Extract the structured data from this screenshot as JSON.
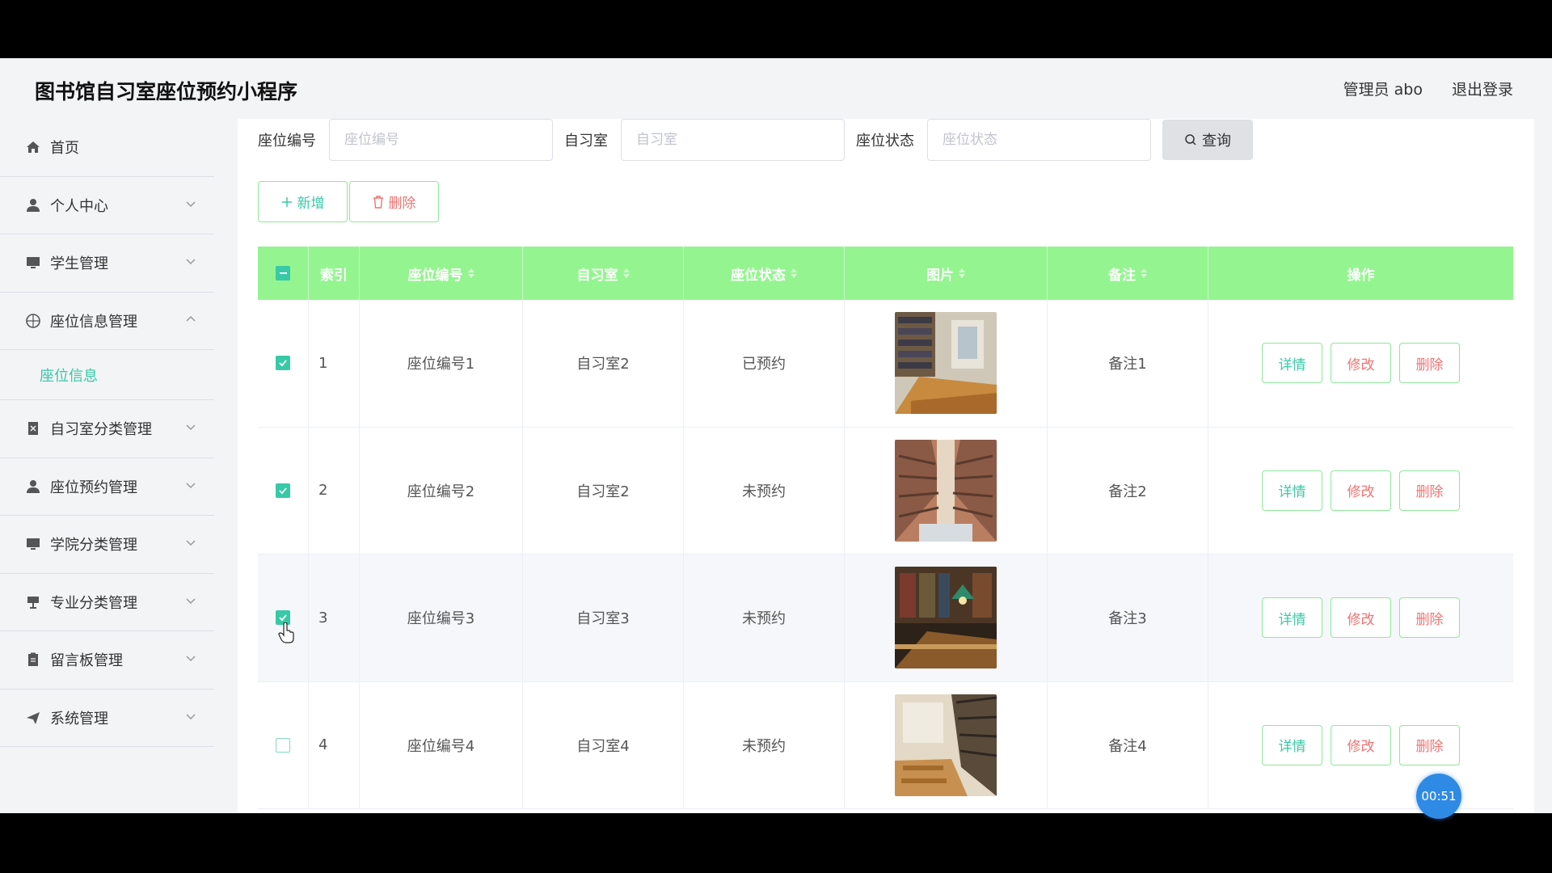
{
  "app": {
    "title": "图书馆自习室座位预约小程序",
    "user": "管理员 abo",
    "logout": "退出登录"
  },
  "sidebar": {
    "items": [
      {
        "label": "首页",
        "icon": "home-icon"
      },
      {
        "label": "个人中心",
        "icon": "user-icon"
      },
      {
        "label": "学生管理",
        "icon": "monitor-icon"
      },
      {
        "label": "座位信息管理",
        "icon": "compass-icon",
        "expanded": true
      },
      {
        "label": "自习室分类管理",
        "icon": "doc-icon"
      },
      {
        "label": "座位预约管理",
        "icon": "user-icon"
      },
      {
        "label": "学院分类管理",
        "icon": "monitor-icon"
      },
      {
        "label": "专业分类管理",
        "icon": "stand-icon"
      },
      {
        "label": "留言板管理",
        "icon": "clipboard-icon"
      },
      {
        "label": "系统管理",
        "icon": "send-icon"
      }
    ],
    "submenu_label": "座位信息"
  },
  "search": {
    "seat_no_label": "座位编号",
    "seat_no_placeholder": "座位编号",
    "room_label": "自习室",
    "room_placeholder": "自习室",
    "status_label": "座位状态",
    "status_placeholder": "座位状态",
    "button": "查询"
  },
  "actions": {
    "add": "新增",
    "delete": "删除"
  },
  "table": {
    "headers": {
      "index": "索引",
      "seat_no": "座位编号",
      "room": "自习室",
      "status": "座位状态",
      "image": "图片",
      "note": "备注",
      "ops": "操作"
    },
    "rows": [
      {
        "index": "1",
        "seat_no": "座位编号1",
        "room": "自习室2",
        "status": "已预约",
        "note": "备注1",
        "checked": true
      },
      {
        "index": "2",
        "seat_no": "座位编号2",
        "room": "自习室2",
        "status": "未预约",
        "note": "备注2",
        "checked": true
      },
      {
        "index": "3",
        "seat_no": "座位编号3",
        "room": "自习室3",
        "status": "未预约",
        "note": "备注3",
        "checked": true
      },
      {
        "index": "4",
        "seat_no": "座位编号4",
        "room": "自习室4",
        "status": "未预约",
        "note": "备注4",
        "checked": false
      }
    ],
    "op_labels": {
      "detail": "详情",
      "edit": "修改",
      "delete": "删除"
    }
  },
  "timer": "00:51",
  "colors": {
    "accent": "#38c9a6",
    "header_green": "#94f590",
    "danger": "#f07474",
    "timer_blue": "#2f8ae6"
  }
}
